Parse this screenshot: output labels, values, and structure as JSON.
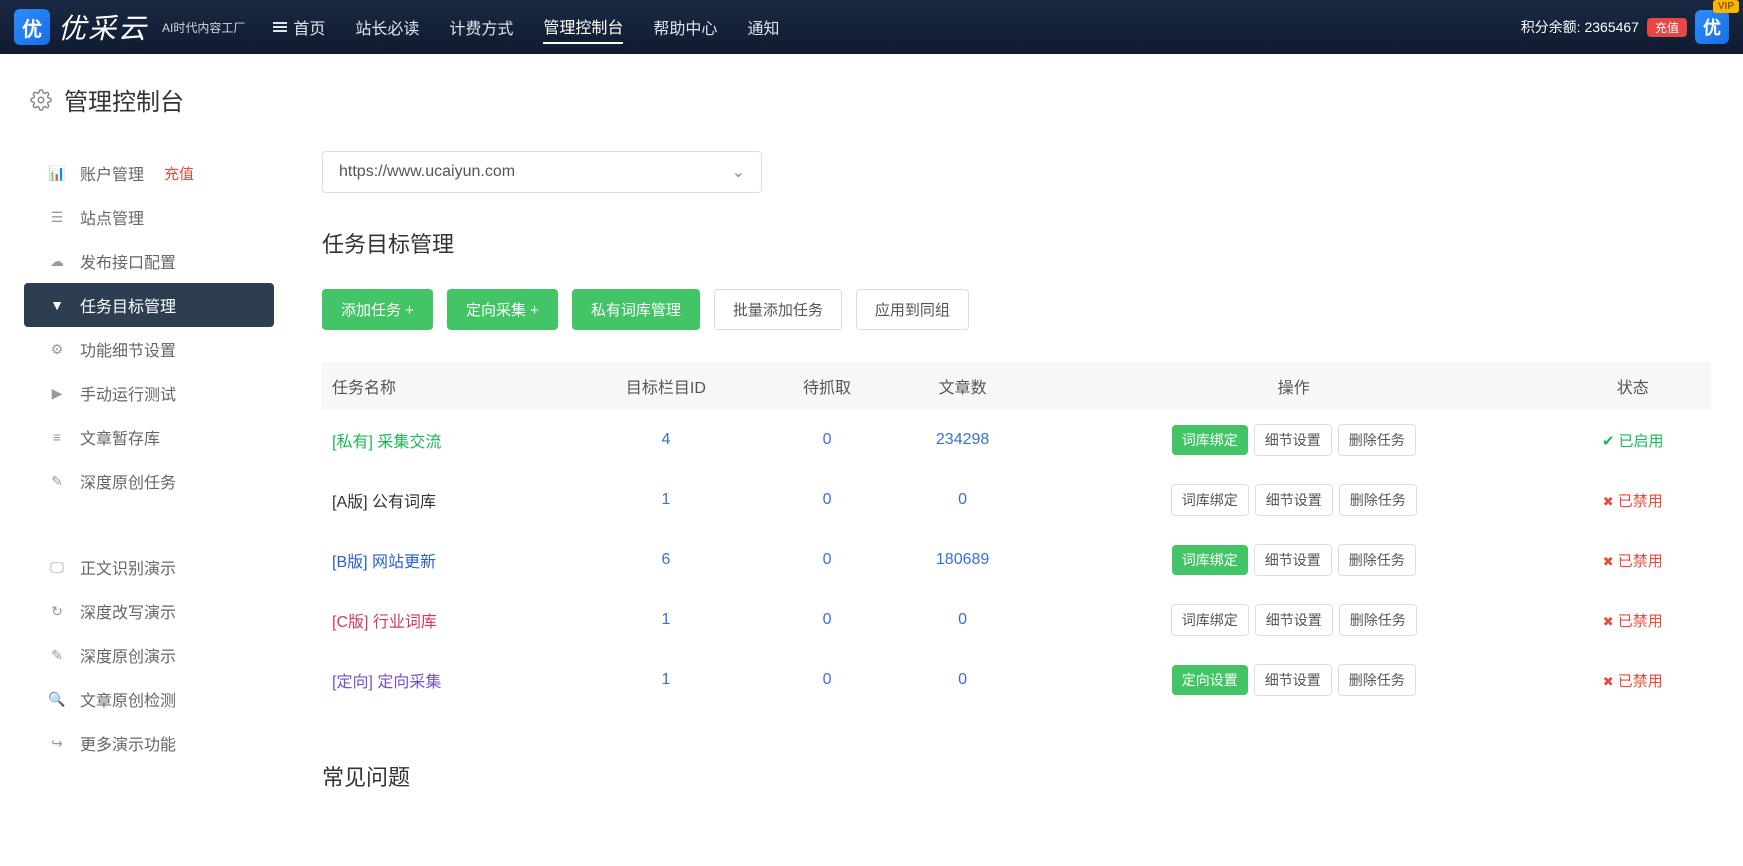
{
  "navbar": {
    "logo_text": "优采云",
    "logo_glyph": "优",
    "logo_sub": "AI时代内容工厂",
    "items": [
      "首页",
      "站长必读",
      "计费方式",
      "管理控制台",
      "帮助中心",
      "通知"
    ],
    "active_index": 3,
    "balance_label": "积分余额:",
    "balance_value": "2365467",
    "recharge": "充值",
    "vip": "VIP",
    "avatar_glyph": "优"
  },
  "page": {
    "title": "管理控制台"
  },
  "sidebar": {
    "items_a": [
      {
        "icon": "chart",
        "label": "账户管理",
        "badge": "充值"
      },
      {
        "icon": "list",
        "label": "站点管理"
      },
      {
        "icon": "cloud",
        "label": "发布接口配置"
      },
      {
        "icon": "filter",
        "label": "任务目标管理",
        "active": true
      },
      {
        "icon": "cogs",
        "label": "功能细节设置"
      },
      {
        "icon": "play",
        "label": "手动运行测试"
      },
      {
        "icon": "db",
        "label": "文章暂存库"
      },
      {
        "icon": "edit",
        "label": "深度原创任务"
      }
    ],
    "items_b": [
      {
        "icon": "monitor",
        "label": "正文识别演示"
      },
      {
        "icon": "refresh",
        "label": "深度改写演示"
      },
      {
        "icon": "edit",
        "label": "深度原创演示"
      },
      {
        "icon": "search",
        "label": "文章原创检测"
      },
      {
        "icon": "share",
        "label": "更多演示功能"
      }
    ]
  },
  "main": {
    "site_select_value": "https://www.ucaiyun.com",
    "section_title": "任务目标管理",
    "buttons": {
      "add_task": "添加任务 +",
      "targeted": "定向采集 +",
      "private_dict": "私有词库管理",
      "bulk_add": "批量添加任务",
      "apply_group": "应用到同组"
    },
    "table": {
      "headers": [
        "任务名称",
        "目标栏目ID",
        "待抓取",
        "文章数",
        "操作",
        "状态"
      ],
      "rows": [
        {
          "tag": "[私有]",
          "tag_class": "tag-private",
          "name": "采集交流",
          "col_id": "4",
          "pending": "0",
          "articles": "234298",
          "op1": "词库绑定",
          "op1_style": "mini-green",
          "detail": "细节设置",
          "del": "删除任务",
          "status": "已启用",
          "status_class": "status-on tick"
        },
        {
          "tag": "[A版]",
          "tag_class": "tag-a",
          "name": "公有词库",
          "col_id": "1",
          "pending": "0",
          "articles": "0",
          "op1": "词库绑定",
          "op1_style": "mini-outline",
          "detail": "细节设置",
          "del": "删除任务",
          "status": "已禁用",
          "status_class": "status-off cross"
        },
        {
          "tag": "[B版]",
          "tag_class": "tag-b",
          "name": "网站更新",
          "col_id": "6",
          "pending": "0",
          "articles": "180689",
          "op1": "词库绑定",
          "op1_style": "mini-green",
          "detail": "细节设置",
          "del": "删除任务",
          "status": "已禁用",
          "status_class": "status-off cross"
        },
        {
          "tag": "[C版]",
          "tag_class": "tag-c",
          "name": "行业词库",
          "col_id": "1",
          "pending": "0",
          "articles": "0",
          "op1": "词库绑定",
          "op1_style": "mini-outline",
          "detail": "细节设置",
          "del": "删除任务",
          "status": "已禁用",
          "status_class": "status-off cross"
        },
        {
          "tag": "[定向]",
          "tag_class": "tag-dx",
          "name": "定向采集",
          "col_id": "1",
          "pending": "0",
          "articles": "0",
          "op1": "定向设置",
          "op1_style": "mini-green",
          "detail": "细节设置",
          "del": "删除任务",
          "status": "已禁用",
          "status_class": "status-off cross"
        }
      ]
    },
    "faq_title": "常见问题"
  },
  "icons": {
    "chart": "📊",
    "list": "☰",
    "cloud": "☁",
    "filter": "▼",
    "cogs": "⚙",
    "play": "▶",
    "db": "≡",
    "edit": "✎",
    "monitor": "🖵",
    "refresh": "↻",
    "search": "🔍",
    "share": "↪"
  }
}
